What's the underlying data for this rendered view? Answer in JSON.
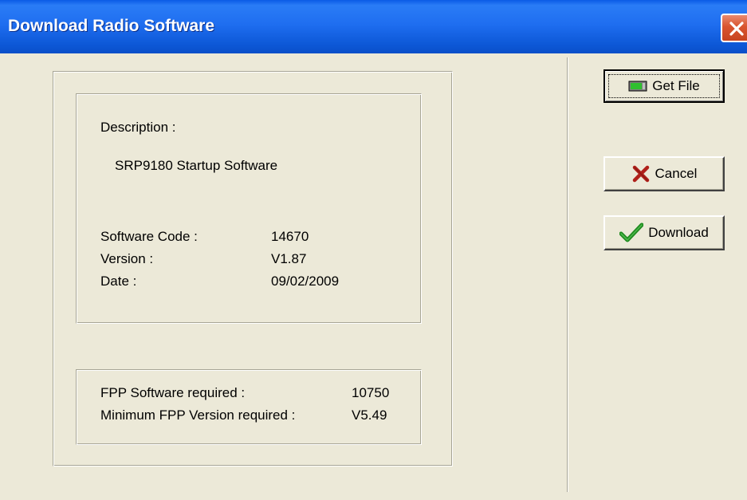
{
  "window": {
    "title": "Download Radio Software"
  },
  "description": {
    "label": "Description :",
    "value": "SRP9180 Startup Software"
  },
  "software_info": {
    "code_label": "Software Code :",
    "code_value": "14670",
    "version_label": "Version :",
    "version_value": "V1.87",
    "date_label": "Date :",
    "date_value": "09/02/2009"
  },
  "fpp": {
    "software_label": "FPP Software required :",
    "software_value": "10750",
    "min_version_label": "Minimum FPP Version required :",
    "min_version_value": "V5.49"
  },
  "buttons": {
    "get_file": "Get File",
    "cancel": "Cancel",
    "download": "Download"
  },
  "colors": {
    "titlebar": "#0a5ae6",
    "dialog_bg": "#ece9d8",
    "close_button": "#d9542f",
    "cancel_icon": "#b0201a",
    "download_icon": "#1f8a1f",
    "getfile_icon": "#2fbf2f"
  },
  "icons": {
    "close": "close-icon",
    "get_file": "file-icon",
    "cancel": "x-icon",
    "download": "checkmark-icon"
  }
}
